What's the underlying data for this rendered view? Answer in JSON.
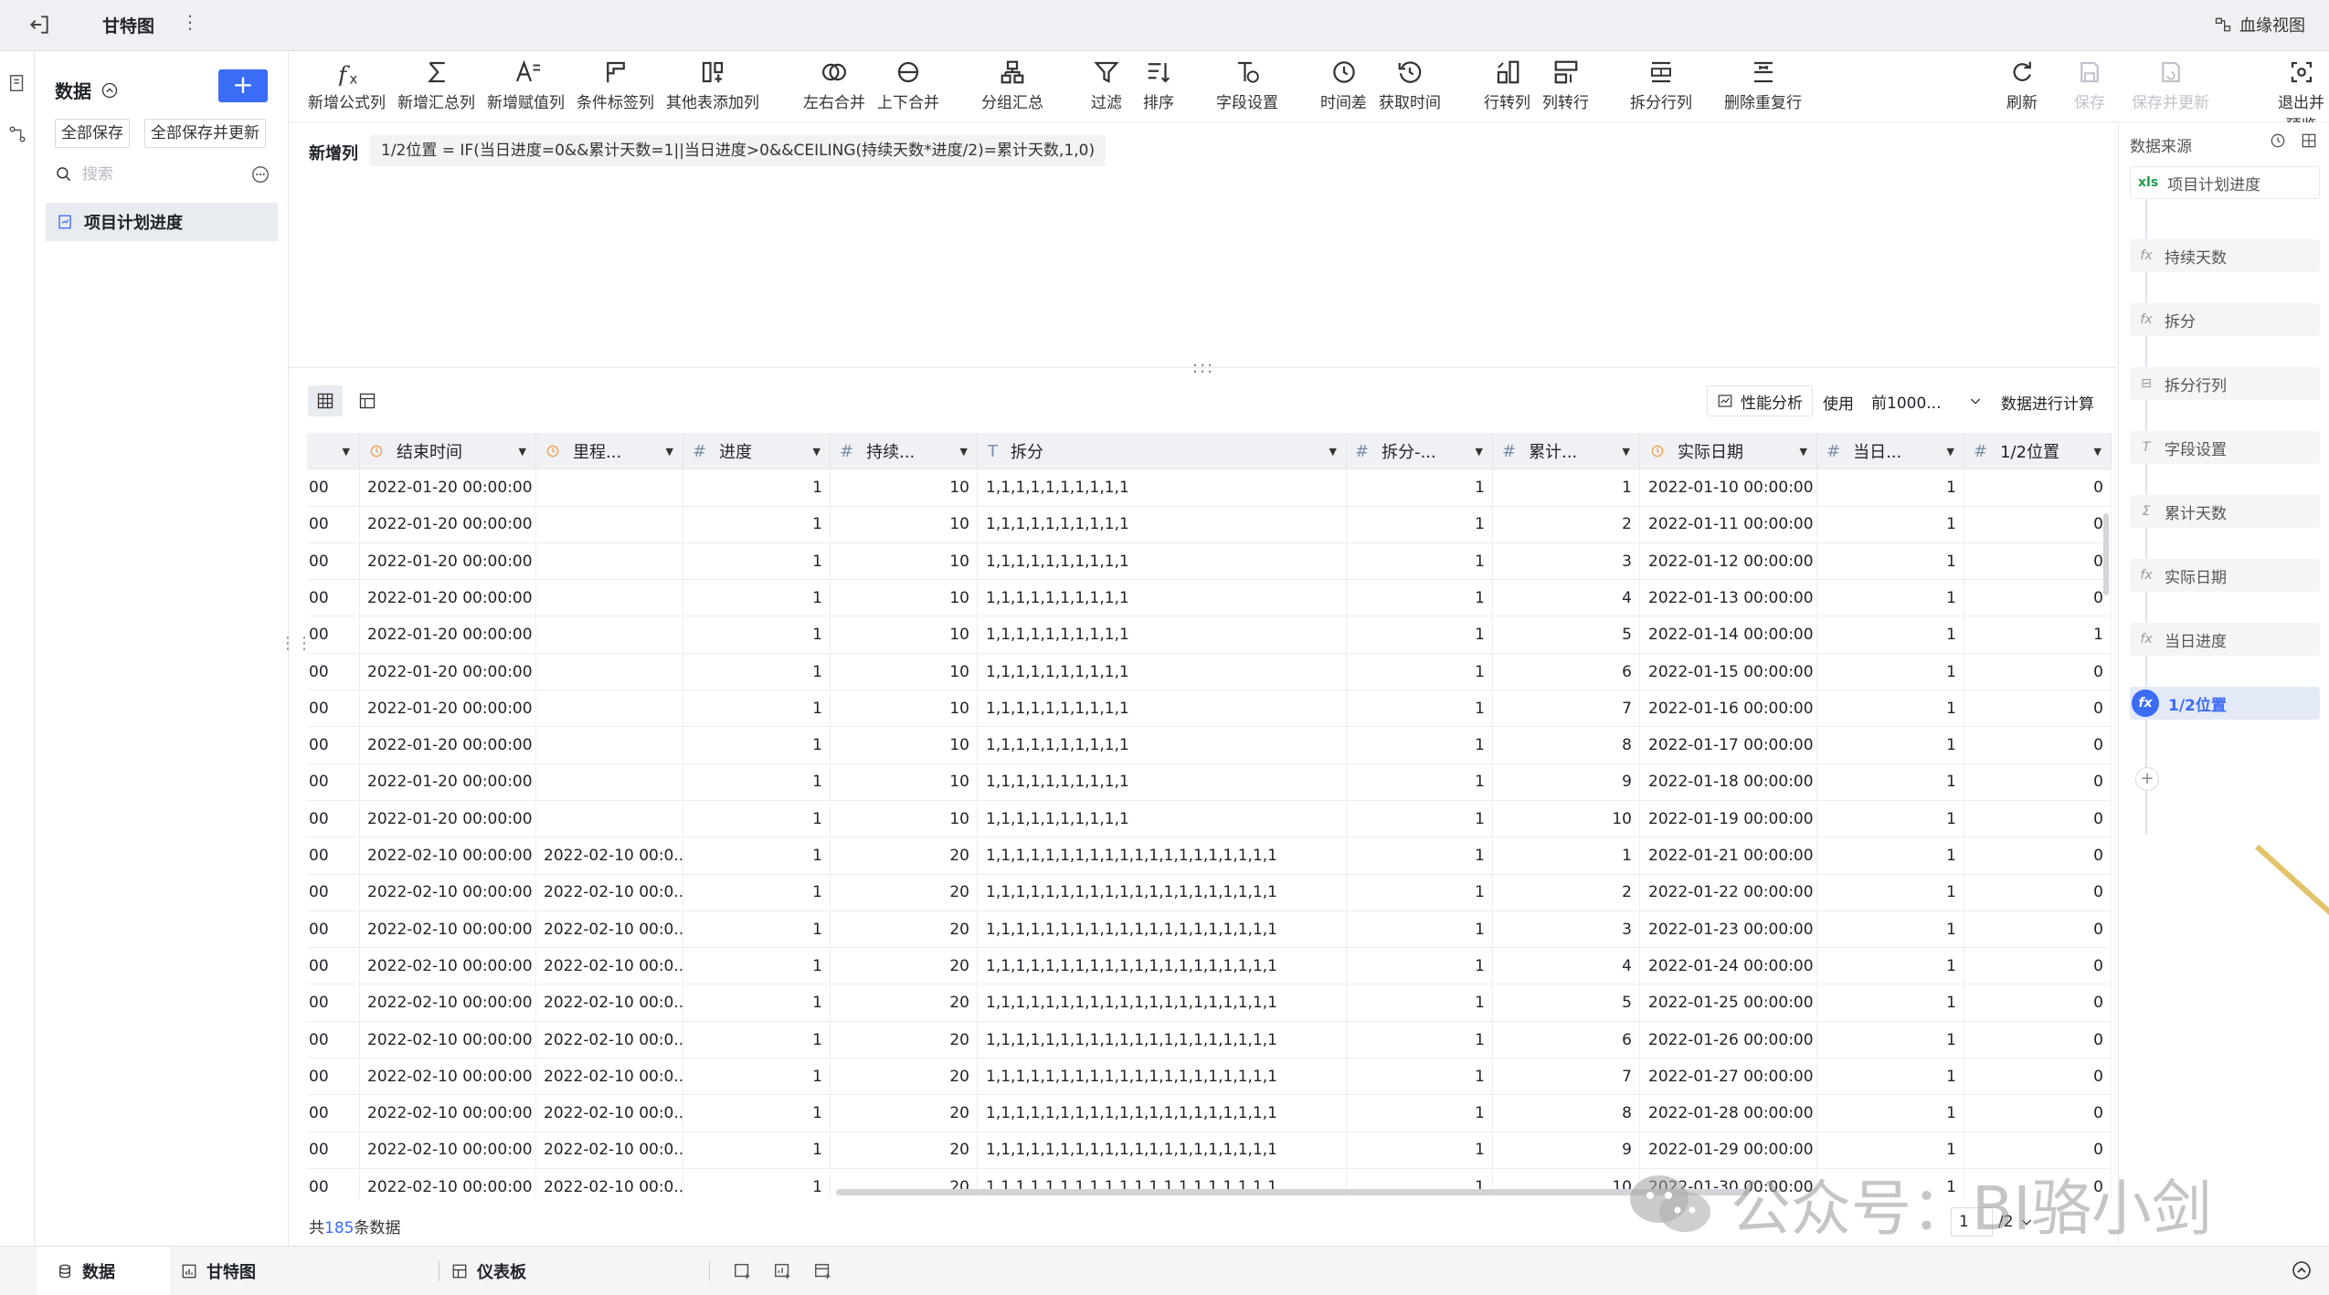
{
  "topbar": {
    "title": "甘特图",
    "lineage": "血缘视图"
  },
  "left_panel": {
    "title": "数据",
    "save_all": "全部保存",
    "save_all_update": "全部保存并更新",
    "search_placeholder": "搜索",
    "item": "项目计划进度"
  },
  "toolbar": [
    {
      "label": "新增公式列",
      "icon": "fx-icon"
    },
    {
      "label": "新增汇总列",
      "icon": "sigma-icon"
    },
    {
      "label": "新增赋值列",
      "icon": "assign-icon"
    },
    {
      "label": "条件标签列",
      "icon": "tag-icon"
    },
    {
      "label": "其他表添加列",
      "icon": "add-col-icon"
    },
    {
      "label": "左右合并",
      "icon": "merge-lr-icon"
    },
    {
      "label": "上下合并",
      "icon": "merge-ud-icon"
    },
    {
      "label": "分组汇总",
      "icon": "group-icon"
    },
    {
      "label": "过滤",
      "icon": "filter-icon"
    },
    {
      "label": "排序",
      "icon": "sort-icon"
    },
    {
      "label": "字段设置",
      "icon": "field-icon"
    },
    {
      "label": "时间差",
      "icon": "clock-icon"
    },
    {
      "label": "获取时间",
      "icon": "get-time-icon"
    },
    {
      "label": "行转列",
      "icon": "row-col-icon"
    },
    {
      "label": "列转行",
      "icon": "col-row-icon"
    },
    {
      "label": "拆分行列",
      "icon": "split-icon"
    },
    {
      "label": "删除重复行",
      "icon": "dedupe-icon"
    },
    {
      "label": "刷新",
      "icon": "refresh-icon"
    },
    {
      "label": "保存",
      "icon": "save-icon"
    },
    {
      "label": "保存并更新",
      "icon": "save-update-icon"
    },
    {
      "label": "退出并预览",
      "icon": "exit-preview-icon"
    }
  ],
  "formula": {
    "label": "新增列",
    "text": "1/2位置 = IF(当日进度=0&&累计天数=1||当日进度>0&&CEILING(持续天数*进度/2)=累计天数,1,0)"
  },
  "table_controls": {
    "perf": "性能分析",
    "use": "使用",
    "use_value": "前1000...",
    "use_after": "数据进行计算"
  },
  "columns": [
    {
      "label": "",
      "type": "partial"
    },
    {
      "label": "结束时间",
      "type": "date"
    },
    {
      "label": "里程...",
      "type": "date"
    },
    {
      "label": "进度",
      "type": "num"
    },
    {
      "label": "持续...",
      "type": "num"
    },
    {
      "label": "拆分",
      "type": "text"
    },
    {
      "label": "拆分-...",
      "type": "num"
    },
    {
      "label": "累计...",
      "type": "num"
    },
    {
      "label": "实际日期",
      "type": "date"
    },
    {
      "label": "当日...",
      "type": "num"
    },
    {
      "label": "1/2位置",
      "type": "num"
    }
  ],
  "rows": [
    [
      "00",
      "2022-01-20 00:00:00",
      "",
      "1",
      "10",
      "1,1,1,1,1,1,1,1,1,1",
      "1",
      "1",
      "2022-01-10 00:00:00",
      "1",
      "0"
    ],
    [
      "00",
      "2022-01-20 00:00:00",
      "",
      "1",
      "10",
      "1,1,1,1,1,1,1,1,1,1",
      "1",
      "2",
      "2022-01-11 00:00:00",
      "1",
      "0"
    ],
    [
      "00",
      "2022-01-20 00:00:00",
      "",
      "1",
      "10",
      "1,1,1,1,1,1,1,1,1,1",
      "1",
      "3",
      "2022-01-12 00:00:00",
      "1",
      "0"
    ],
    [
      "00",
      "2022-01-20 00:00:00",
      "",
      "1",
      "10",
      "1,1,1,1,1,1,1,1,1,1",
      "1",
      "4",
      "2022-01-13 00:00:00",
      "1",
      "0"
    ],
    [
      "00",
      "2022-01-20 00:00:00",
      "",
      "1",
      "10",
      "1,1,1,1,1,1,1,1,1,1",
      "1",
      "5",
      "2022-01-14 00:00:00",
      "1",
      "1"
    ],
    [
      "00",
      "2022-01-20 00:00:00",
      "",
      "1",
      "10",
      "1,1,1,1,1,1,1,1,1,1",
      "1",
      "6",
      "2022-01-15 00:00:00",
      "1",
      "0"
    ],
    [
      "00",
      "2022-01-20 00:00:00",
      "",
      "1",
      "10",
      "1,1,1,1,1,1,1,1,1,1",
      "1",
      "7",
      "2022-01-16 00:00:00",
      "1",
      "0"
    ],
    [
      "00",
      "2022-01-20 00:00:00",
      "",
      "1",
      "10",
      "1,1,1,1,1,1,1,1,1,1",
      "1",
      "8",
      "2022-01-17 00:00:00",
      "1",
      "0"
    ],
    [
      "00",
      "2022-01-20 00:00:00",
      "",
      "1",
      "10",
      "1,1,1,1,1,1,1,1,1,1",
      "1",
      "9",
      "2022-01-18 00:00:00",
      "1",
      "0"
    ],
    [
      "00",
      "2022-01-20 00:00:00",
      "",
      "1",
      "10",
      "1,1,1,1,1,1,1,1,1,1",
      "1",
      "10",
      "2022-01-19 00:00:00",
      "1",
      "0"
    ],
    [
      "00",
      "2022-02-10 00:00:00",
      "2022-02-10 00:0...",
      "1",
      "20",
      "1,1,1,1,1,1,1,1,1,1,1,1,1,1,1,1,1,1,1,1",
      "1",
      "1",
      "2022-01-21 00:00:00",
      "1",
      "0"
    ],
    [
      "00",
      "2022-02-10 00:00:00",
      "2022-02-10 00:0...",
      "1",
      "20",
      "1,1,1,1,1,1,1,1,1,1,1,1,1,1,1,1,1,1,1,1",
      "1",
      "2",
      "2022-01-22 00:00:00",
      "1",
      "0"
    ],
    [
      "00",
      "2022-02-10 00:00:00",
      "2022-02-10 00:0...",
      "1",
      "20",
      "1,1,1,1,1,1,1,1,1,1,1,1,1,1,1,1,1,1,1,1",
      "1",
      "3",
      "2022-01-23 00:00:00",
      "1",
      "0"
    ],
    [
      "00",
      "2022-02-10 00:00:00",
      "2022-02-10 00:0...",
      "1",
      "20",
      "1,1,1,1,1,1,1,1,1,1,1,1,1,1,1,1,1,1,1,1",
      "1",
      "4",
      "2022-01-24 00:00:00",
      "1",
      "0"
    ],
    [
      "00",
      "2022-02-10 00:00:00",
      "2022-02-10 00:0...",
      "1",
      "20",
      "1,1,1,1,1,1,1,1,1,1,1,1,1,1,1,1,1,1,1,1",
      "1",
      "5",
      "2022-01-25 00:00:00",
      "1",
      "0"
    ],
    [
      "00",
      "2022-02-10 00:00:00",
      "2022-02-10 00:0...",
      "1",
      "20",
      "1,1,1,1,1,1,1,1,1,1,1,1,1,1,1,1,1,1,1,1",
      "1",
      "6",
      "2022-01-26 00:00:00",
      "1",
      "0"
    ],
    [
      "00",
      "2022-02-10 00:00:00",
      "2022-02-10 00:0...",
      "1",
      "20",
      "1,1,1,1,1,1,1,1,1,1,1,1,1,1,1,1,1,1,1,1",
      "1",
      "7",
      "2022-01-27 00:00:00",
      "1",
      "0"
    ],
    [
      "00",
      "2022-02-10 00:00:00",
      "2022-02-10 00:0...",
      "1",
      "20",
      "1,1,1,1,1,1,1,1,1,1,1,1,1,1,1,1,1,1,1,1",
      "1",
      "8",
      "2022-01-28 00:00:00",
      "1",
      "0"
    ],
    [
      "00",
      "2022-02-10 00:00:00",
      "2022-02-10 00:0...",
      "1",
      "20",
      "1,1,1,1,1,1,1,1,1,1,1,1,1,1,1,1,1,1,1,1",
      "1",
      "9",
      "2022-01-29 00:00:00",
      "1",
      "0"
    ],
    [
      "00",
      "2022-02-10 00:00:00",
      "2022-02-10 00:0...",
      "1",
      "20",
      "1,1,1,1,1,1,1,1,1,1,1,1,1,1,1,1,1,1,1,1",
      "1",
      "10",
      "2022-01-30 00:00:00",
      "1",
      "0"
    ]
  ],
  "footer": {
    "total_prefix": "共",
    "total_count": "185",
    "total_suffix": "条数据",
    "page": "1",
    "pages": "/2"
  },
  "right_panel": {
    "title": "数据来源",
    "source_badge": "xls",
    "source": "项目计划进度",
    "nodes": [
      {
        "label": "持续天数",
        "icon": "fx"
      },
      {
        "label": "拆分",
        "icon": "fx"
      },
      {
        "label": "拆分行列",
        "icon": "split"
      },
      {
        "label": "字段设置",
        "icon": "field"
      },
      {
        "label": "累计天数",
        "icon": "sigma"
      },
      {
        "label": "实际日期",
        "icon": "fx"
      },
      {
        "label": "当日进度",
        "icon": "fx"
      },
      {
        "label": "1/2位置",
        "icon": "fx",
        "active": true
      }
    ]
  },
  "bottom_tabs": [
    "数据",
    "甘特图",
    "仪表板"
  ],
  "watermark": "公众号：BI骆小剑",
  "colors": {
    "accent": "#3b6cf6",
    "date_icon": "#f0a050",
    "num_icon": "#7a8ea8"
  }
}
